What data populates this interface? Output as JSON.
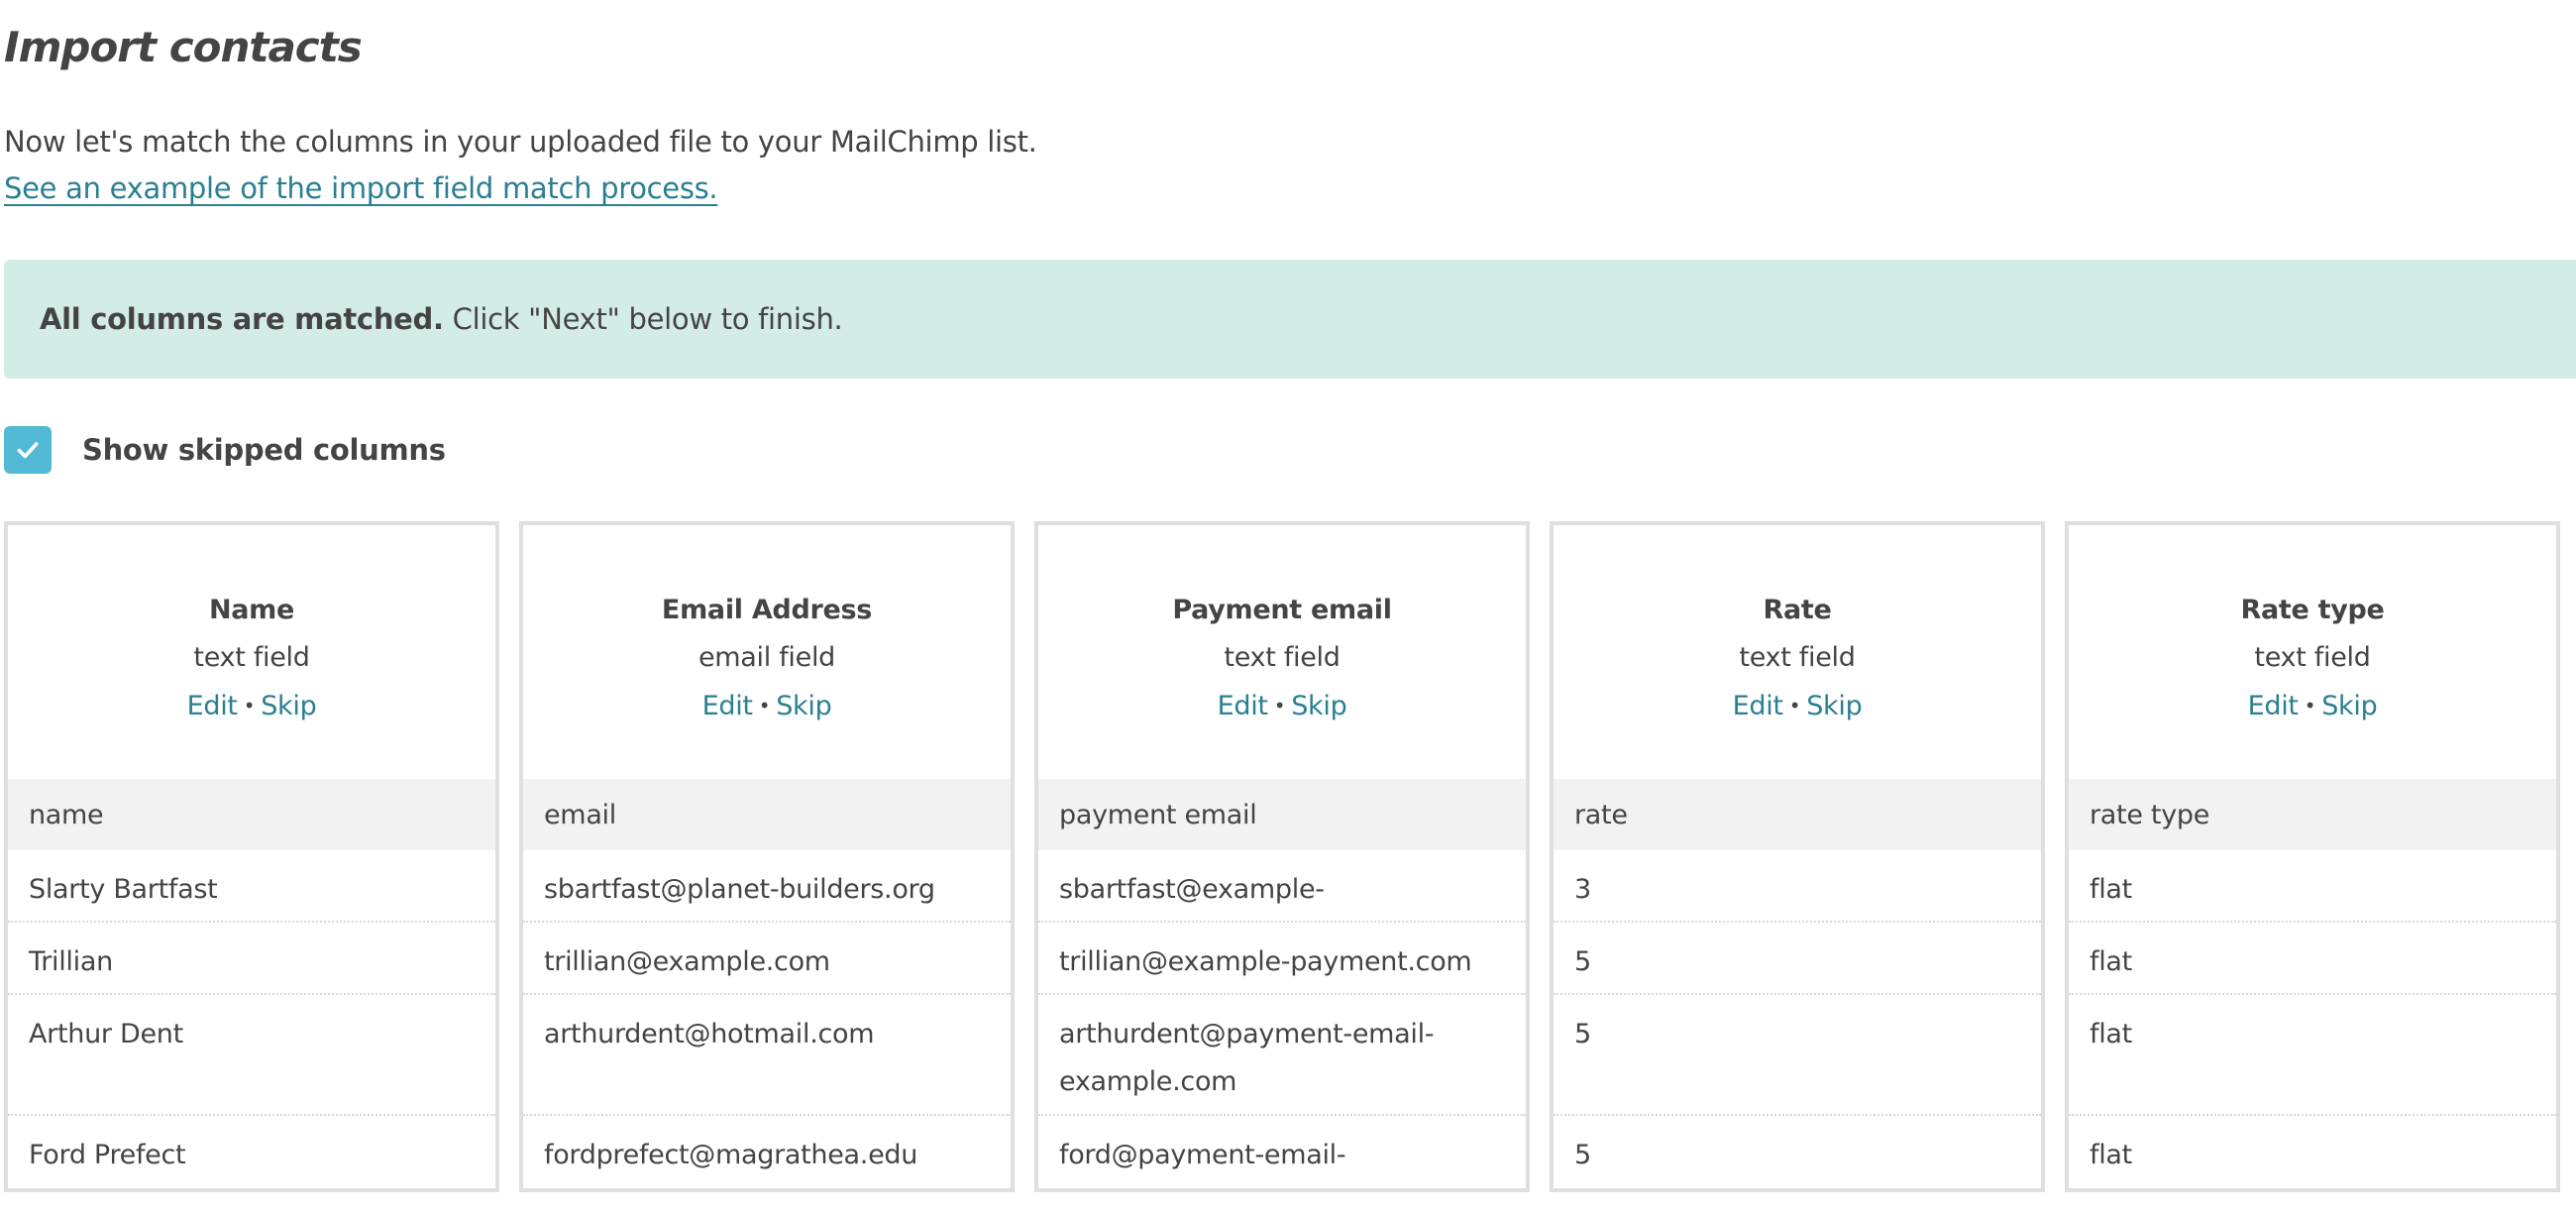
{
  "page": {
    "title": "Import contacts",
    "intro_text": "Now let's match the columns in your uploaded file to your MailChimp list.",
    "example_link": "See an example of the import field match process."
  },
  "banner": {
    "bold_text": "All columns are matched.",
    "text": " Click \"Next\" below to finish.",
    "background_color": "#d4ece6"
  },
  "skip_toggle": {
    "label": "Show skipped columns",
    "checked": true,
    "icon": "checkmark-icon",
    "color": "#52bad5"
  },
  "actions": {
    "edit_label": "Edit",
    "separator": "•",
    "skip_label": "Skip",
    "link_color": "#2a7f92"
  },
  "columns": [
    {
      "field_name": "Name",
      "field_type": "text field",
      "source_header": "name",
      "values": [
        "Slarty Bartfast",
        "Trillian",
        "Arthur Dent",
        "Ford Prefect"
      ]
    },
    {
      "field_name": "Email Address",
      "field_type": "email field",
      "source_header": "email",
      "values": [
        "sbartfast@planet-builders.org",
        "trillian@example.com",
        "arthurdent@hotmail.com",
        "fordprefect@magrathea.edu"
      ]
    },
    {
      "field_name": "Payment email",
      "field_type": "text field",
      "source_header": "payment email",
      "values": [
        "sbartfast@example-payment.com",
        "trillian@example-payment.com",
        "arthurdent@payment-email-example.com",
        "ford@payment-email-example.com"
      ]
    },
    {
      "field_name": "Rate",
      "field_type": "text field",
      "source_header": "rate",
      "values": [
        "3",
        "5",
        "5",
        "5"
      ]
    },
    {
      "field_name": "Rate type",
      "field_type": "text field",
      "source_header": "rate type",
      "values": [
        "flat",
        "flat",
        "flat",
        "flat"
      ]
    }
  ]
}
